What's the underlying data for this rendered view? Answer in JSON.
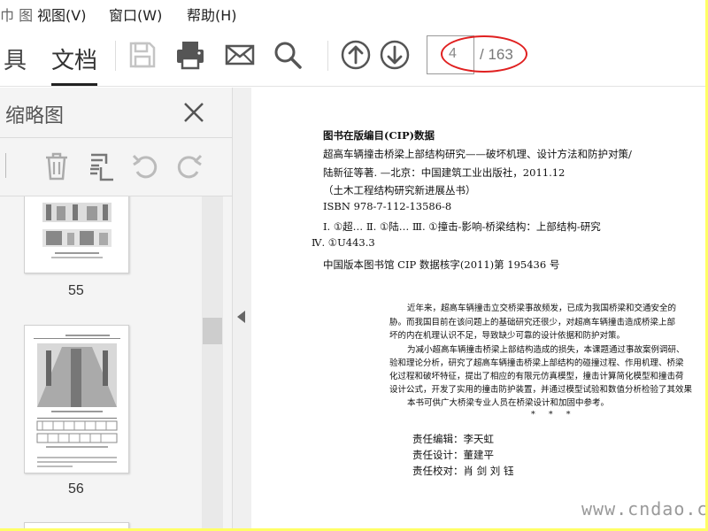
{
  "menubar": {
    "partial": "巾 图",
    "view": "视图(V)",
    "window": "窗口(W)",
    "help": "帮助(H)"
  },
  "toolbar": {
    "tools_tab": "具",
    "document_tab": "文档",
    "current_page": "4",
    "total_pages": "/ 163"
  },
  "thumbnails_panel": {
    "title": "缩略图",
    "pages": [
      {
        "label": "55"
      },
      {
        "label": "56"
      }
    ]
  },
  "document": {
    "cip_heading": "图书在版编目(CIP)数据",
    "cip_lines": [
      "超高车辆撞击桥梁上部结构研究——破坏机理、设计方法和防护对策/",
      "陆新征等著. —北京：中国建筑工业出版社，2011.12",
      "（土木工程结构研究新进展丛书）",
      "ISBN 978-7-112-13586-8",
      "Ⅰ. ①超…   Ⅱ. ①陆…   Ⅲ. ①撞击-影响-桥梁结构：上部结构-研究",
      "Ⅳ. ①U443.3"
    ],
    "cip_record": "中国版本图书馆 CIP 数据核字(2011)第 195436 号",
    "abstract_lines": [
      "近年来，超高车辆撞击立交桥梁事故频发，已成为我国桥梁和交通安全的",
      "胁。而我国目前在该问题上的基础研究还很少，对超高车辆撞击造成桥梁上部",
      "坏的内在机理认识不足，导致缺少可靠的设计依据和防护对策。",
      "为减小超高车辆撞击桥梁上部结构造成的损失，本课题通过事故案例调研、",
      "验和理论分析，研究了超高车辆撞击桥梁上部结构的碰撞过程、作用机理、桥梁",
      "化过程和破坏特征，提出了相应的有限元仿真模型，撞击计算简化模型和撞击荷",
      "设计公式，开发了实用的撞击防护装置，并通过模型试验和数值分析检验了其效果",
      "本书可供广大桥梁专业人员在桥梁设计和加固中参考。"
    ],
    "separator": "*     *     *",
    "credits": [
      "责任编辑：李天虹",
      "责任设计：董建平",
      "责任校对：肖  剑  刘  钰"
    ],
    "watermark": "www.cndao.com"
  },
  "colors": {
    "highlight_ellipse": "#e02020",
    "outer_border": "#ffff66"
  }
}
